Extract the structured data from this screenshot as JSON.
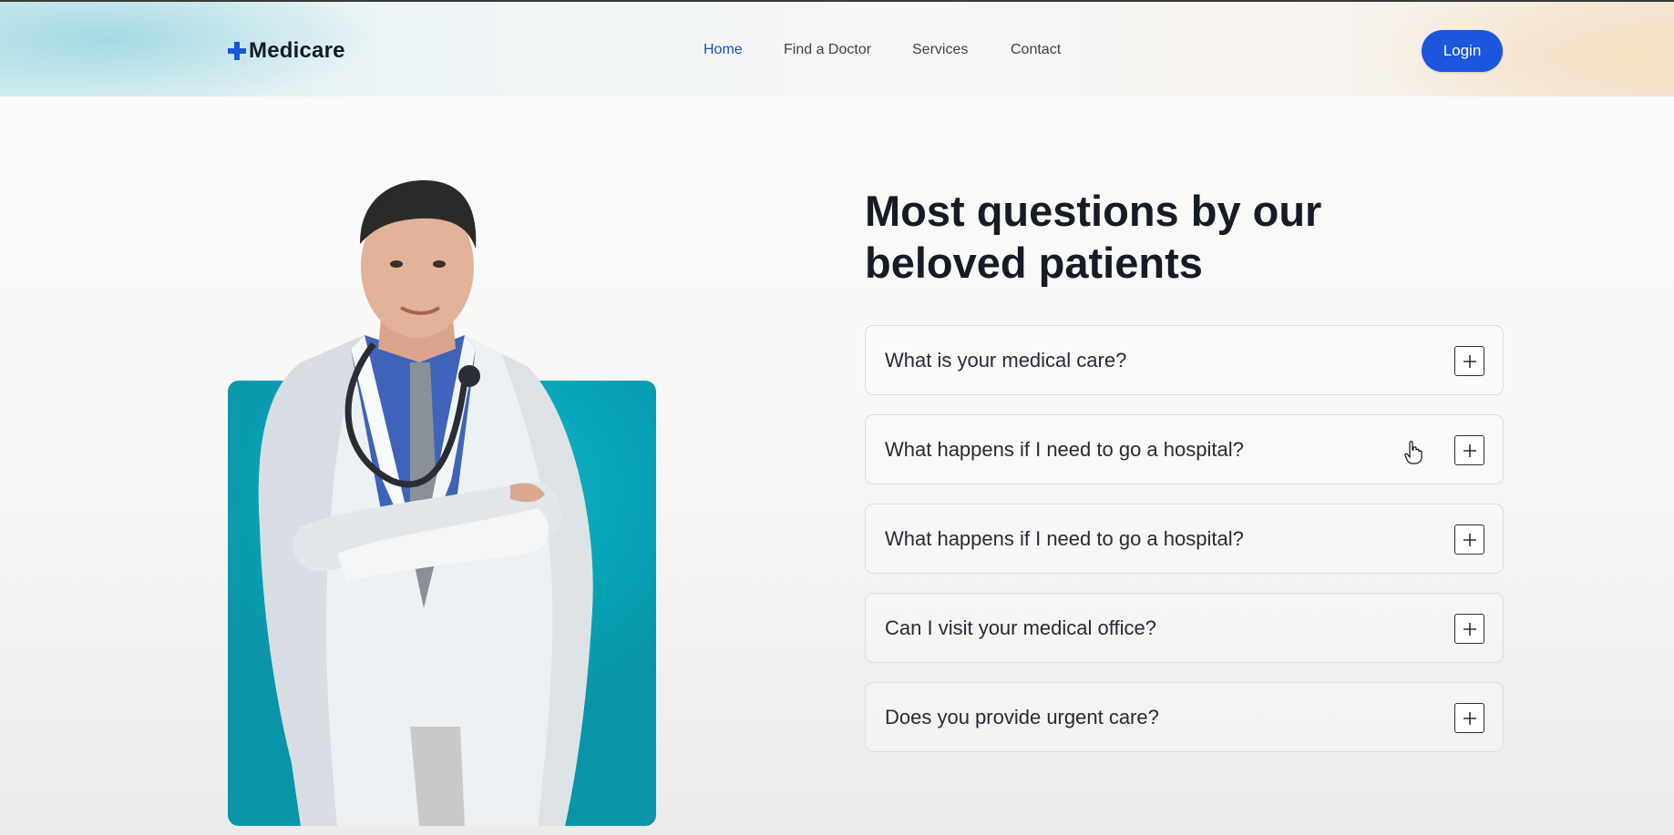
{
  "header": {
    "brand": "Medicare",
    "brand_icon": "medical-cross-icon",
    "nav": [
      {
        "label": "Home",
        "active": true
      },
      {
        "label": "Find a Doctor",
        "active": false
      },
      {
        "label": "Services",
        "active": false
      },
      {
        "label": "Contact",
        "active": false
      }
    ],
    "login_label": "Login"
  },
  "colors": {
    "primary": "#1c55de",
    "nav_active": "#1d4fb5",
    "card_teal": "#08a5b8"
  },
  "faq": {
    "title": "Most questions by our beloved patients",
    "items": [
      {
        "question": "What is your medical care?",
        "icon": "plus-icon"
      },
      {
        "question": "What happens if I need to go a hospital?",
        "icon": "plus-icon"
      },
      {
        "question": "What happens if I need to go a hospital?",
        "icon": "plus-icon"
      },
      {
        "question": "Can I visit your medical office?",
        "icon": "plus-icon"
      },
      {
        "question": "Does you provide urgent care?",
        "icon": "plus-icon"
      }
    ]
  }
}
